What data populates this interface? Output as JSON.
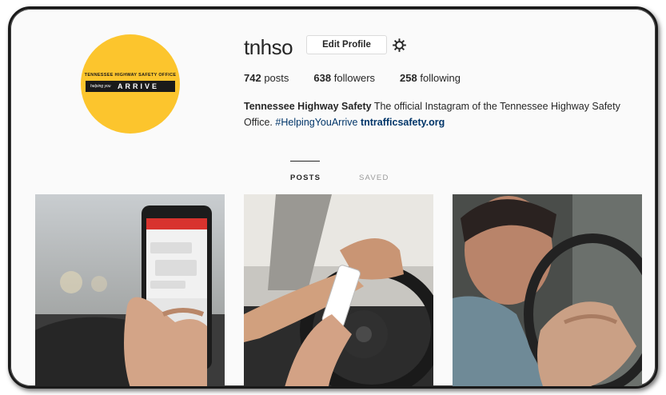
{
  "profile": {
    "username": "tnhso",
    "edit_profile_label": "Edit Profile",
    "logo": {
      "line1": "TENNESSEE HIGHWAY SAFETY OFFICE",
      "helping": "helping you",
      "arrive": "ARRIVE"
    },
    "stats": {
      "posts_count": "742",
      "posts_label": "posts",
      "followers_count": "638",
      "followers_label": "followers",
      "following_count": "258",
      "following_label": "following"
    },
    "bio": {
      "name": "Tennessee Highway Safety",
      "text": "The official Instagram of the Tennessee Highway Safety Office.",
      "hashtag": "#HelpingYouArrive",
      "link": "tntrafficsafety.org"
    }
  },
  "tabs": {
    "posts": "POSTS",
    "saved": "SAVED"
  },
  "icons": {
    "settings": "gear-icon"
  },
  "colors": {
    "logo_yellow": "#fcc52d",
    "link_blue": "#003569",
    "border": "#dbdbdb"
  }
}
